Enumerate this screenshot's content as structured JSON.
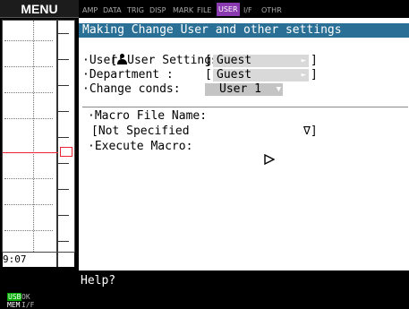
{
  "menu": {
    "label": "MENU"
  },
  "tabs": [
    {
      "label": "AMP"
    },
    {
      "label": "DATA"
    },
    {
      "label": "TRIG"
    },
    {
      "label": "DISP"
    },
    {
      "label": "MARK"
    },
    {
      "label": "FILE"
    },
    {
      "label": "USER",
      "active": true
    },
    {
      "label": "I/F"
    },
    {
      "label": "OTHR"
    }
  ],
  "panel": {
    "title": "Making Change User and other settings",
    "section": "[ User Settings]",
    "user_label": "·User:",
    "user_bracket_open": "[",
    "user_value": "Guest",
    "user_bracket_close": "]",
    "dept_label": "·Department :",
    "dept_bracket_open": "[",
    "dept_value": "Guest",
    "dept_bracket_close": "]",
    "conds_label": "·Change conds:",
    "conds_value": "User 1",
    "macro_file_label": "·Macro File Name:",
    "macro_file_value": "[Not Specified",
    "macro_file_close": "∇]",
    "execute_label": "·Execute Macro:",
    "execute_icon": "play-icon"
  },
  "graph": {
    "time_label": "9:07"
  },
  "status": {
    "usb": "USB",
    "mem": "MEM",
    "ok": "OK",
    "if": "I/F"
  },
  "help": {
    "text": "Help?"
  },
  "colors": {
    "title_bg": "#2a6f95",
    "active_tab": "#8a3ab0",
    "field_bg": "#d9d9d9",
    "trigger": "#e23"
  }
}
